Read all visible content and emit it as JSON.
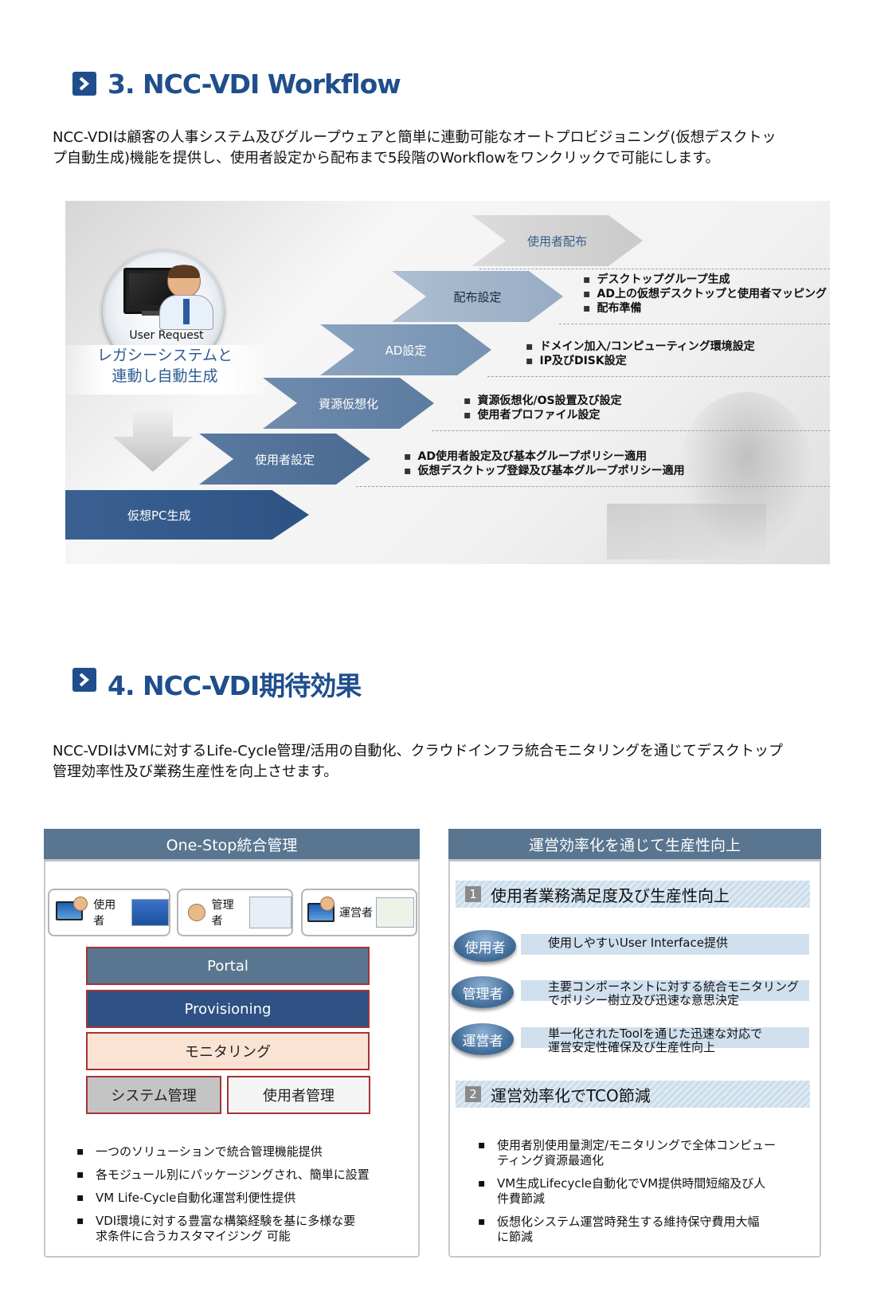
{
  "section3": {
    "title": "3. NCC-VDI Workflow",
    "intro_line1": "NCC-VDIは顧客の人事システム及びグループウェアと簡単に連動可能なオートプロビジョニング(仮想デスクトッ",
    "intro_line2": "プ自動生成)機能を提供し、使用者設定から配布まで5段階のWorkflowをワンクリックで可能にします。"
  },
  "workflow": {
    "user_request": "User Request",
    "legacy_line1": "レガシーシステムと",
    "legacy_line2": "連動し自動生成",
    "steps": [
      "使用者配布",
      "配布設定",
      "AD設定",
      "資源仮想化",
      "使用者設定",
      "仮想PC生成"
    ],
    "haifu_bullets": [
      "デスクトップグループ生成",
      "AD上の仮想デスクトップと使用者マッピング",
      "配布準備"
    ],
    "ad_bullets": [
      "ドメイン加入/コンピューティング環境設定",
      "IP及びDISK設定"
    ],
    "shigen_bullets": [
      "資源仮想化/OS設置及び設定",
      "使用者プロファイル設定"
    ],
    "user_bullets": [
      "AD使用者設定及び基本グループポリシー適用",
      "仮想デスクトップ登録及び基本グループポリシー適用"
    ]
  },
  "section4": {
    "title": "4. NCC-VDI期待効果",
    "intro_line1": "NCC-VDIはVMに対するLife-Cycle管理/活用の自動化、クラウドインフラ統合モニタリングを通じてデスクトップ",
    "intro_line2": "管理効率性及び業務生産性を向上させます。"
  },
  "left_panel": {
    "header": "One-Stop統合管理",
    "roles": [
      "使用者",
      "管理者",
      "運営者"
    ],
    "layers": {
      "portal": "Portal",
      "provisioning": "Provisioning",
      "monitoring": "モニタリング",
      "system": "システム管理",
      "user": "使用者管理"
    },
    "bullets": [
      "一つのソリューションで統合管理機能提供",
      "各モジュール別にパッケージングされ、簡単に設置",
      "VM Life-Cycle自動化運営利便性提供",
      "VDI環境に対する豊富な構築経験を基に多様な要",
      "求条件に合うカスタマイジング 可能"
    ]
  },
  "right_panel": {
    "header": "運営効率化を通じて生産性向上",
    "section1": {
      "num": "1",
      "title": "使用者業務満足度及び生産性向上"
    },
    "rows": [
      {
        "role": "使用者",
        "line1": "使用しやすいUser Interface提供",
        "line2": ""
      },
      {
        "role": "管理者",
        "line1": "主要コンポーネントに対する統合モニタリング",
        "line2": "でポリシー樹立及び迅速な意思決定"
      },
      {
        "role": "運営者",
        "line1": "単一化されたToolを通じた迅速な対応で",
        "line2": "運営安定性確保及び生産性向上"
      }
    ],
    "section2": {
      "num": "2",
      "title": "運営効率化でTCO節減"
    },
    "bullets": [
      {
        "line1": "使用者別使用量測定/モニタリングで全体コンピュー",
        "line2": "ティング資源最適化"
      },
      {
        "line1": "VM生成Lifecycle自動化でVM提供時間短縮及び人",
        "line2": "件費節減"
      },
      {
        "line1": "仮想化システム運営時発生する維持保守費用大幅",
        "line2": "に節減"
      }
    ]
  }
}
